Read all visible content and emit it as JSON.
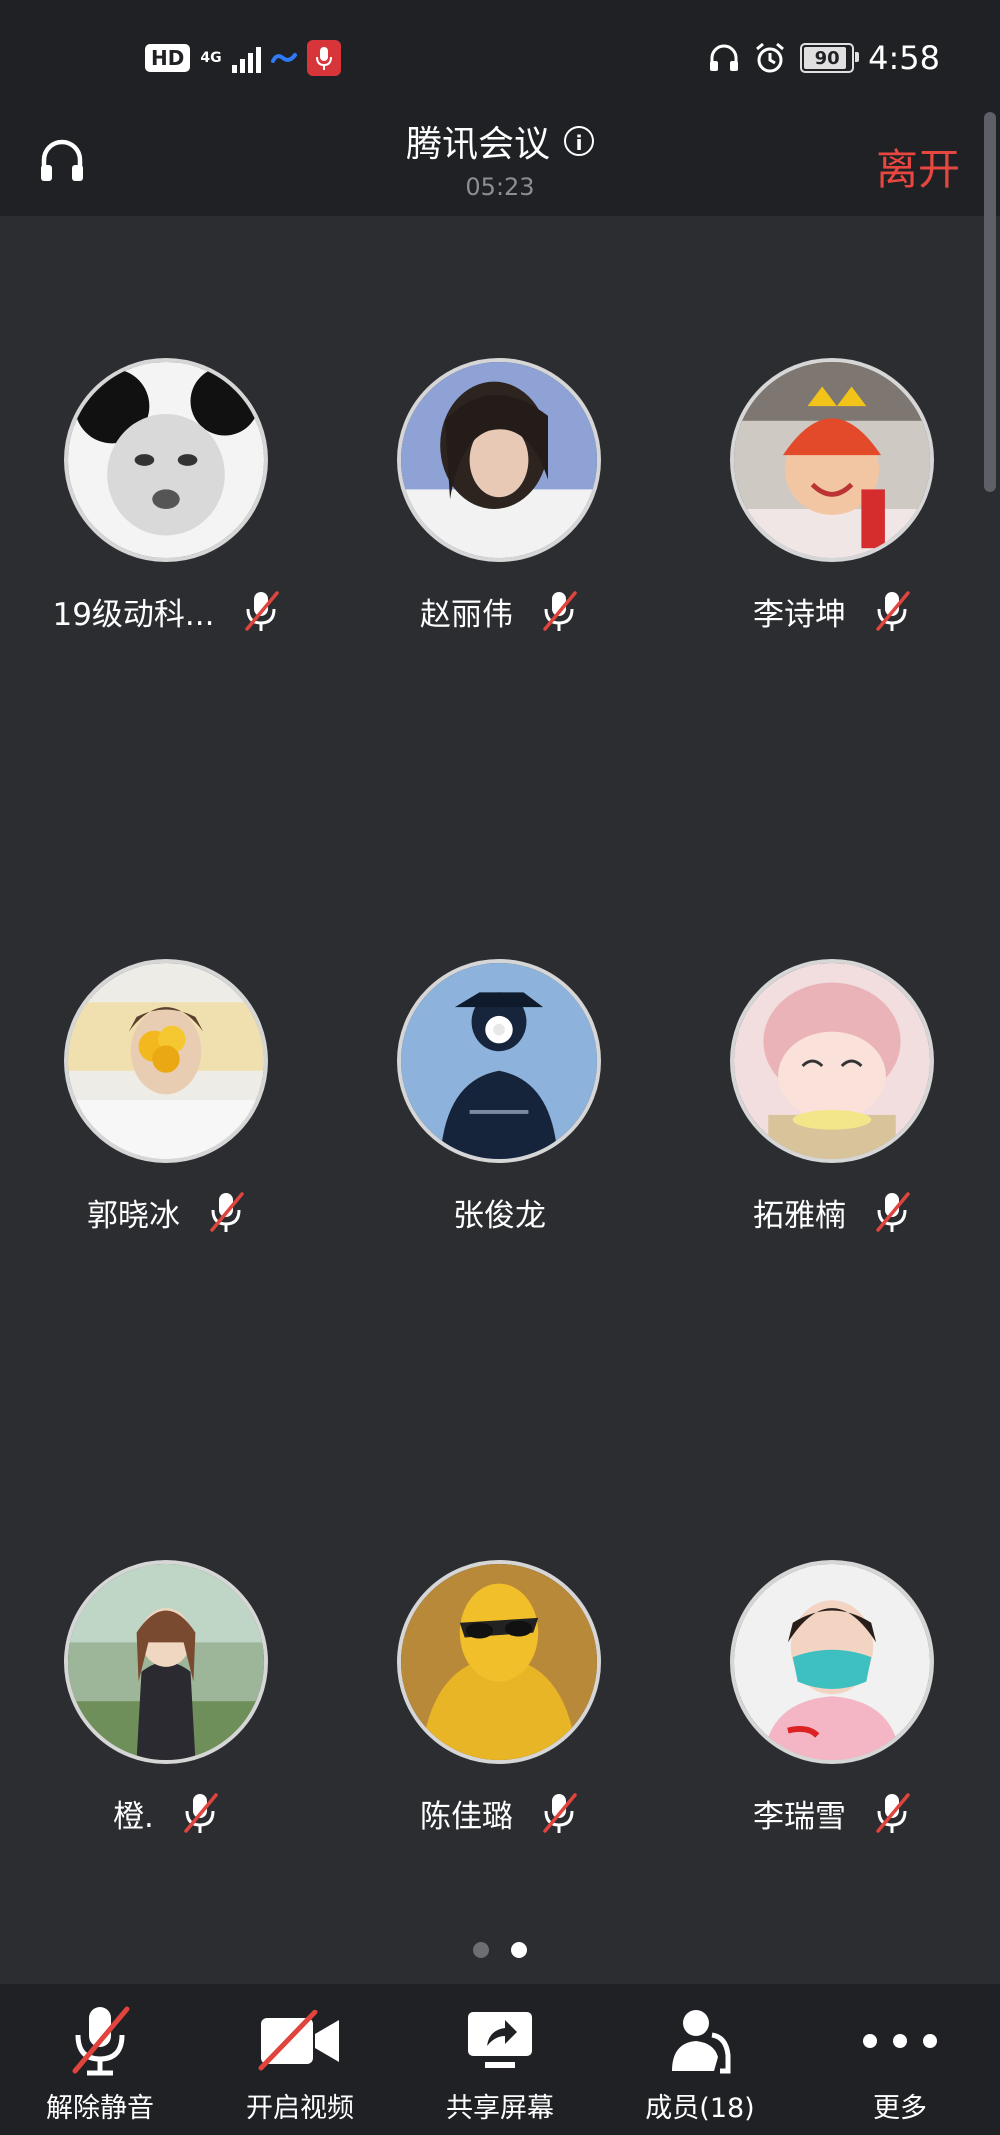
{
  "status_bar": {
    "hd": "HD",
    "network": "4G",
    "battery": "90",
    "time": "4:58"
  },
  "header": {
    "title": "腾讯会议",
    "timer": "05:23",
    "leave_label": "离开"
  },
  "participants": [
    {
      "name": "19级动科...",
      "muted": true
    },
    {
      "name": "赵丽伟",
      "muted": true
    },
    {
      "name": "李诗坤",
      "muted": true
    },
    {
      "name": "郭晓冰",
      "muted": true
    },
    {
      "name": "张俊龙",
      "muted": false
    },
    {
      "name": "拓雅楠",
      "muted": true
    },
    {
      "name": "橙.",
      "muted": true
    },
    {
      "name": "陈佳璐",
      "muted": true
    },
    {
      "name": "李瑞雪",
      "muted": true
    }
  ],
  "pager": {
    "total": 2,
    "current": 2
  },
  "toolbar": {
    "unmute": "解除静音",
    "video": "开启视频",
    "share": "共享屏幕",
    "members": "成员(18)",
    "more": "更多"
  },
  "colors": {
    "background": "#2b2d31",
    "bar": "#1f2124",
    "leave": "#e8473f",
    "mute_slash": "#e0443c"
  }
}
